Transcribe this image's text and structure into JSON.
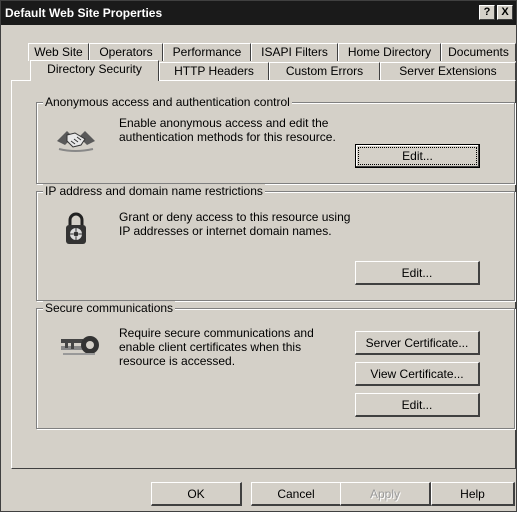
{
  "window": {
    "title": "Default Web Site Properties",
    "help_label": "?",
    "close_label": "X"
  },
  "tabs_row1": [
    "Web Site",
    "Operators",
    "Performance",
    "ISAPI Filters",
    "Home Directory",
    "Documents"
  ],
  "tabs_row2": [
    "Directory Security",
    "HTTP Headers",
    "Custom Errors",
    "Server Extensions"
  ],
  "active_tab": "Directory Security",
  "anonymous": {
    "legend": "Anonymous access and authentication control",
    "line1": "Enable anonymous access and edit the",
    "line2": "authentication methods for this resource.",
    "edit_label": "Edit...",
    "icon": "handshake-icon"
  },
  "ip": {
    "legend": "IP address and domain name restrictions",
    "line1": "Grant or deny access to this resource using",
    "line2": "IP addresses or internet domain names.",
    "edit_label": "Edit...",
    "icon": "padlock-icon"
  },
  "secure": {
    "legend": "Secure communications",
    "line1": "Require secure communications and",
    "line2": "enable client certificates when this",
    "line3": "resource is accessed.",
    "server_cert_label": "Server Certificate...",
    "view_cert_label": "View Certificate...",
    "edit_label": "Edit...",
    "icon": "key-icon"
  },
  "footer": {
    "ok": "OK",
    "cancel": "Cancel",
    "apply": "Apply",
    "help": "Help"
  }
}
